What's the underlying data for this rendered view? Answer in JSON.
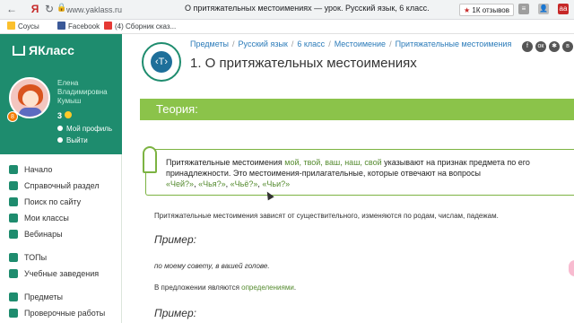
{
  "browser": {
    "back": "←",
    "yandex": "Я",
    "reload": "↻",
    "url": "www.yaklass.ru",
    "page_title": "О притяжательных местоимениях — урок. Русский язык, 6 класс.",
    "reviews": "1К отзывов",
    "reviews_star": "★",
    "ext1": "≡",
    "ext2": "👤",
    "ext3": "aa"
  },
  "bookmarks": [
    {
      "label": "Соусы",
      "color": "#fbc02d"
    },
    {
      "label": "Facebook",
      "color": "#3b5998"
    },
    {
      "label": "(4) Сборник сказ...",
      "color": "#e53935"
    }
  ],
  "sidebar": {
    "logo": "ЯКласс",
    "user_name": "Елена Владимировна Кумыш",
    "level": "8",
    "score": "3",
    "profile_link": "Мой профиль",
    "logout_link": "Выйти",
    "menu": [
      {
        "label": "Начало",
        "gap": false
      },
      {
        "label": "Справочный раздел",
        "gap": false
      },
      {
        "label": "Поиск по сайту",
        "gap": false
      },
      {
        "label": "Мои классы",
        "gap": false
      },
      {
        "label": "Вебинары",
        "gap": false
      },
      {
        "label": "ТОПы",
        "gap": true
      },
      {
        "label": "Учебные заведения",
        "gap": false
      },
      {
        "label": "Предметы",
        "gap": true
      },
      {
        "label": "Проверочные работы",
        "gap": false
      }
    ]
  },
  "header": {
    "breadcrumbs": [
      "Предметы",
      "Русский язык",
      "6 класс",
      "Местоимение",
      "Притяжательные местоимения"
    ],
    "title": "1. О притяжательных местоимениях",
    "lesson_icon": "‹Т›",
    "social": [
      {
        "name": "facebook-icon",
        "glyph": "f"
      },
      {
        "name": "odnoklassniki-icon",
        "glyph": "ок"
      },
      {
        "name": "pinterest-icon",
        "glyph": "✱"
      },
      {
        "name": "vk-icon",
        "glyph": "в"
      },
      {
        "name": "share-icon",
        "glyph": "⋯"
      }
    ]
  },
  "content": {
    "section_title": "Теория:",
    "note_line1_a": "Притяжательные местоимения ",
    "note_line1_b": "мой, твой, ваш, наш, свой",
    "note_line1_c": " указывают на признак предмета по его",
    "note_line2": "принадлежности. Это местоимения-прилагательные, которые отвечают на вопросы",
    "q1": "«Чей?»",
    "q2": "«Чья?»",
    "q3": "«Чьё?»",
    "q4": "«Чьи?»",
    "comma": ", ",
    "para1": "Притяжательные местоимения зависят от существительного, изменяются по родам, числам, падежам.",
    "example_label": "Пример:",
    "example_text": "по моему совету, в вашей голове.",
    "para2_a": "В предложении являются ",
    "para2_b": "определениями",
    "para2_c": ".",
    "example_label2": "Пример:"
  }
}
